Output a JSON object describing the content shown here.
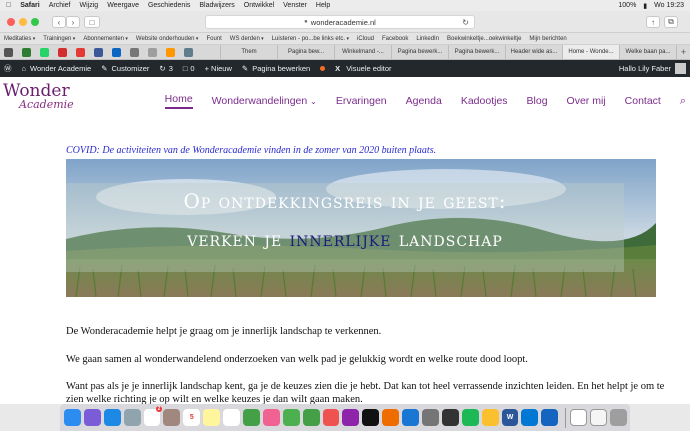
{
  "menubar": {
    "apple": "",
    "app_name": "Safari",
    "items": [
      "Archief",
      "Wijzig",
      "Weergave",
      "Geschiedenis",
      "Bladwijzers",
      "Ontwikkel",
      "Venster",
      "Help"
    ],
    "battery": "100%",
    "battery_icon": "▮",
    "clock": "Wo 19:23"
  },
  "toolbar": {
    "back_icon": "‹",
    "forward_icon": "›",
    "sidebar_icon": "□",
    "url": "wonderacademie.nl",
    "lock_icon": "●",
    "reload_icon": "↻",
    "share_icon": "↑",
    "tabs_icon": "⧉"
  },
  "favorites": {
    "items": [
      "Meditaties",
      "Trainingen",
      "Abonnementen",
      "Website onderhouden",
      "Fount",
      "WS derden",
      "Luisteren - po...be links etc.",
      "iCloud",
      "Facebook",
      "LinkedIn",
      "Boekwinkeltje...oekwinkeltje",
      "Mijn berichten"
    ]
  },
  "tabs": {
    "items": [
      "Them",
      "Pagina bew...",
      "Winkelmand -...",
      "Pagina bewerk...",
      "Pagina bewerk...",
      "Header wide as...",
      "Home - Wonde...",
      "Welke baan pa..."
    ],
    "active_index": 6,
    "plus": "+"
  },
  "wpadmin": {
    "wp_icon": "Ⓦ",
    "site_name": "Wonder Academie",
    "customizer": "Customizer",
    "updates_count": "3",
    "comments_count": "0",
    "new_label": "+ Nieuw",
    "edit_page": "Pagina bewerken",
    "visual_editor": "Visuele editor",
    "greeting": "Hallo Lily Faber"
  },
  "site": {
    "logo_main": "Wonder",
    "logo_sub": "Academie",
    "nav": [
      "Home",
      "Wonderwandelingen",
      "Ervaringen",
      "Agenda",
      "Kadootjes",
      "Blog",
      "Over mij",
      "Contact"
    ],
    "nav_dropdown_icon": "⌄",
    "search_icon": "⌕",
    "covid_notice": "COVID: De activiteiten van de Wonderacademie vinden in de zomer van 2020 buiten plaats.",
    "hero_line1": "Op ontdekkingsreis in je geest:",
    "hero_line2_pre": "verken je ",
    "hero_line2_highlight": "innerlijke",
    "hero_line2_post": " landschap",
    "paragraphs": [
      "De Wonderacademie helpt je graag om je innerlijk landschap te verkennen.",
      "We gaan samen al wonderwandelend onderzoeken van welk pad je gelukkig wordt en welke route dood loopt.",
      "Want pas als je je innerlijk landschap kent, ga je de keuzes zien die je hebt. Dat kan tot heel verrassende inzichten leiden. En het helpt je om te zien welke richting je op wilt en welke keuzes je dan wilt gaan maken."
    ]
  },
  "dock": {
    "calendar_day": "5",
    "mail_badge": "2",
    "word_letter": "W"
  },
  "colors": {
    "brand_purple": "#7b2c8b",
    "covid_blue": "#2a2ad0",
    "wp_bar": "#23282d"
  }
}
